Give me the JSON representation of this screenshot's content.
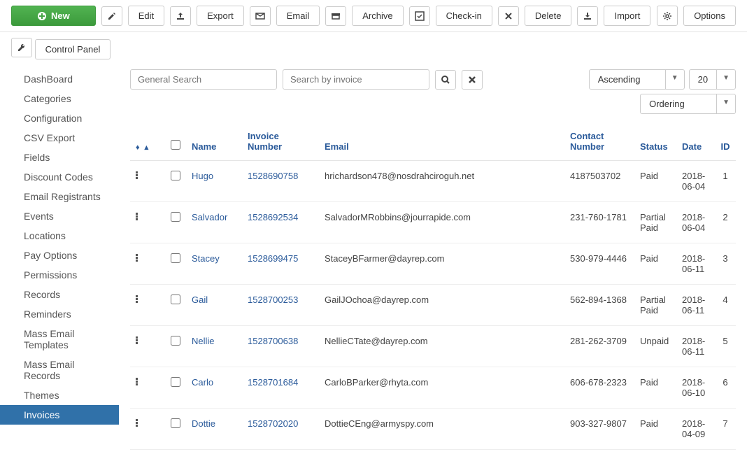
{
  "toolbar": {
    "new": "New",
    "edit": "Edit",
    "export": "Export",
    "email": "Email",
    "archive": "Archive",
    "checkin": "Check-in",
    "delete": "Delete",
    "import": "Import",
    "options": "Options",
    "controlPanel": "Control Panel"
  },
  "sidebar": {
    "items": [
      "DashBoard",
      "Categories",
      "Configuration",
      "CSV Export",
      "Fields",
      "Discount Codes",
      "Email Registrants",
      "Events",
      "Locations",
      "Pay Options",
      "Permissions",
      "Records",
      "Reminders",
      "Mass Email Templates",
      "Mass Email Records",
      "Themes",
      "Invoices"
    ],
    "activeIndex": 16
  },
  "search": {
    "generalPlaceholder": "General Search",
    "invoicePlaceholder": "Search by invoice"
  },
  "controls": {
    "sort": "Ascending",
    "pageSize": "20",
    "ordering": "Ordering"
  },
  "columns": {
    "name": "Name",
    "invoice": "Invoice Number",
    "email": "Email",
    "contact": "Contact Number",
    "status": "Status",
    "date": "Date",
    "id": "ID"
  },
  "rows": [
    {
      "name": "Hugo",
      "invoice": "1528690758",
      "email": "hrichardson478@nosdrahciroguh.net",
      "contact": "4187503702",
      "status": "Paid",
      "date": "2018-06-04",
      "id": "1"
    },
    {
      "name": "Salvador",
      "invoice": "1528692534",
      "email": "SalvadorMRobbins@jourrapide.com",
      "contact": "231-760-1781",
      "status": "Partial Paid",
      "date": "2018-06-04",
      "id": "2"
    },
    {
      "name": "Stacey",
      "invoice": "1528699475",
      "email": "StaceyBFarmer@dayrep.com",
      "contact": "530-979-4446",
      "status": "Paid",
      "date": "2018-06-11",
      "id": "3"
    },
    {
      "name": "Gail",
      "invoice": "1528700253",
      "email": "GailJOchoa@dayrep.com",
      "contact": "562-894-1368",
      "status": "Partial Paid",
      "date": "2018-06-11",
      "id": "4"
    },
    {
      "name": "Nellie",
      "invoice": "1528700638",
      "email": "NellieCTate@dayrep.com",
      "contact": "281-262-3709",
      "status": "Unpaid",
      "date": "2018-06-11",
      "id": "5"
    },
    {
      "name": "Carlo",
      "invoice": "1528701684",
      "email": "CarloBParker@rhyta.com",
      "contact": "606-678-2323",
      "status": "Paid",
      "date": "2018-06-10",
      "id": "6"
    },
    {
      "name": "Dottie",
      "invoice": "1528702020",
      "email": "DottieCEng@armyspy.com",
      "contact": "903-327-9807",
      "status": "Paid",
      "date": "2018-04-09",
      "id": "7"
    }
  ]
}
